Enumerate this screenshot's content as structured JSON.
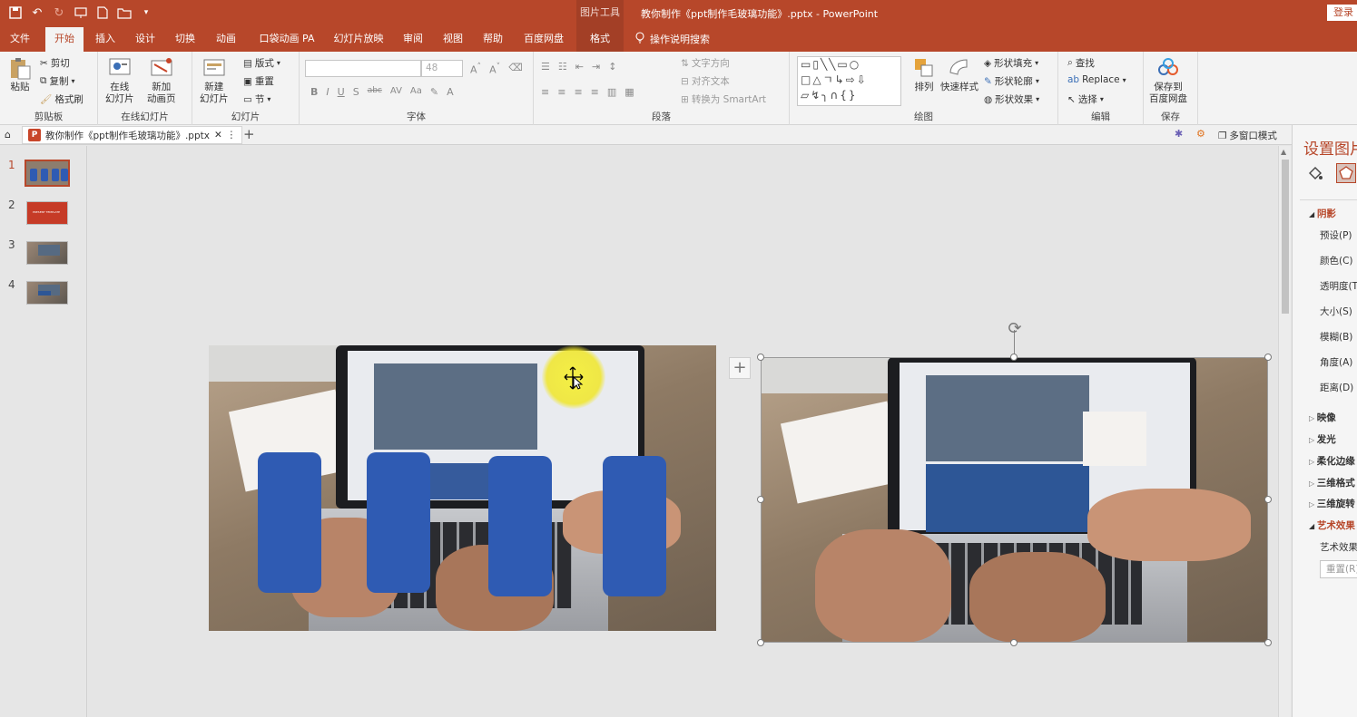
{
  "window": {
    "context_tool": "图片工具",
    "title": "教你制作《ppt制作毛玻璃功能》.pptx - PowerPoint",
    "login": "登录"
  },
  "tabs": [
    "文件",
    "开始",
    "插入",
    "设计",
    "切换",
    "动画",
    "口袋动画 PA",
    "幻灯片放映",
    "审阅",
    "视图",
    "帮助",
    "百度网盘",
    "格式"
  ],
  "tell_me": "操作说明搜索",
  "ribbon": {
    "clipboard": {
      "paste": "粘贴",
      "cut": "剪切",
      "copy": "复制",
      "painter": "格式刷",
      "label": "剪贴板"
    },
    "online": {
      "online_slide": "在线\n幻灯片",
      "new_anim": "新加\n动画页",
      "label": "在线幻灯片"
    },
    "slides": {
      "new_slide": "新建\n幻灯片",
      "layout": "版式",
      "reset": "重置",
      "section": "节",
      "label": "幻灯片"
    },
    "font": {
      "size": "48",
      "bold": "B",
      "italic": "I",
      "underline": "U",
      "shadow": "S",
      "strike": "abc",
      "spacing": "AV",
      "case": "Aa",
      "label": "字体"
    },
    "paragraph": {
      "text_dir": "文字方向",
      "align_text": "对齐文本",
      "smartart": "转换为 SmartArt",
      "label": "段落"
    },
    "drawing": {
      "arrange": "排列",
      "quick_style": "快速样式",
      "fill": "形状填充",
      "outline": "形状轮廓",
      "effects": "形状效果",
      "label": "绘图"
    },
    "editing": {
      "find": "查找",
      "replace": "Replace",
      "select": "选择",
      "label": "编辑"
    },
    "save": {
      "save_baidu": "保存到\n百度网盘",
      "label": "保存"
    }
  },
  "doc_tab": {
    "name": "教你制作《ppt制作毛玻璃功能》.pptx",
    "multi_window": "多窗口模式"
  },
  "slides": [
    {
      "num": "1"
    },
    {
      "num": "2"
    },
    {
      "num": "3"
    },
    {
      "num": "4"
    }
  ],
  "thumb2_text": "PRESENT TEMPLATE",
  "right_pane": {
    "title": "设置图片格式",
    "shadow": "阴影",
    "items": [
      "预设(P)",
      "颜色(C)",
      "透明度(T)",
      "大小(S)",
      "模糊(B)",
      "角度(A)",
      "距离(D)"
    ],
    "sections": [
      "映像",
      "发光",
      "柔化边缘",
      "三维格式",
      "三维旋转"
    ],
    "art_effects": "艺术效果",
    "art_effects_item": "艺术效果",
    "reset": "重置(R)"
  },
  "colors": {
    "accent": "#b7472a",
    "blue_bar": "#2f5bb3"
  }
}
